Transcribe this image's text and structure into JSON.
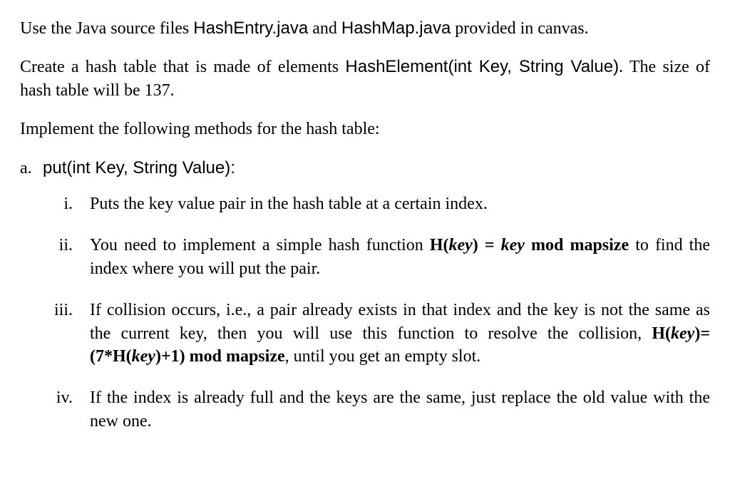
{
  "paragraphs": {
    "p1_a": "Use the Java source files ",
    "p1_file1": "HashEntry.java",
    "p1_b": " and ",
    "p1_file2": "HashMap.java",
    "p1_c": " provided in canvas.",
    "p2_a": "Create a hash table that is made of elements ",
    "p2_sig": "HashElement(int Key, String Value)",
    "p2_b": ". The size of hash table will be 137.",
    "p3": "Implement the following methods for the hash table:"
  },
  "method": {
    "marker": "a.",
    "label": "put(int Key, String Value):"
  },
  "items": {
    "i_marker": "i.",
    "i_text": "Puts the key value pair in the hash table at a certain index.",
    "ii_marker": "ii.",
    "ii_a": "You need to implement a simple hash function ",
    "ii_hk": "H(",
    "ii_key1": "key",
    "ii_hk2": ") = ",
    "ii_key2": "key",
    "ii_mod": " mod mapsize",
    "ii_b": " to find the index where you will put the pair.",
    "iii_marker": "iii.",
    "iii_a": "If collision occurs, i.e., a pair already exists in that index and the key is not the same as the current key, then you will use this function to resolve the collision, ",
    "iii_f_a": "H(",
    "iii_key1": "key",
    "iii_f_b": ")=(7*H(",
    "iii_key2": "key",
    "iii_f_c": ")+1) mod mapsize",
    "iii_b": ", until you get an empty slot.",
    "iv_marker": "iv.",
    "iv_text": "If the index is already full and the keys are the same, just replace the old value with the new one."
  }
}
